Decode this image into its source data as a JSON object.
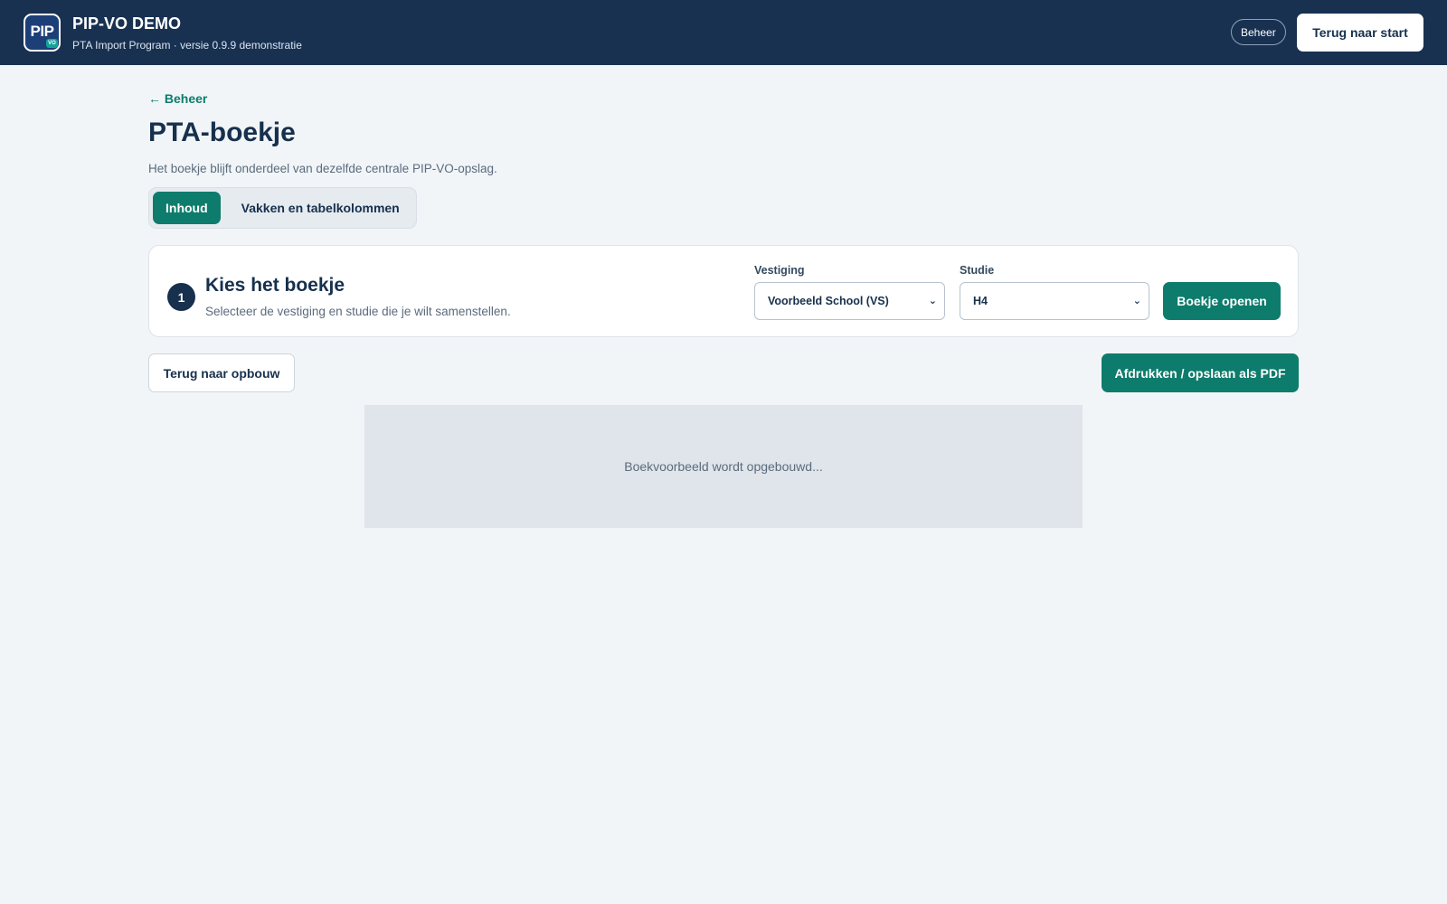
{
  "header": {
    "logo_text": "PIP",
    "logo_badge": "VO",
    "title": "PIP-VO DEMO",
    "subtitle": "PTA Import Program · versie 0.9.9 demonstratie",
    "beheer_label": "Beheer",
    "start_label": "Terug naar start"
  },
  "page": {
    "back_link": "← Beheer",
    "title": "PTA-boekje",
    "subtitle": "Het boekje blijft onderdeel van dezelfde centrale PIP-VO-opslag."
  },
  "tabs": [
    {
      "label": "Inhoud",
      "active": true
    },
    {
      "label": "Vakken en tabelkolommen",
      "active": false
    }
  ],
  "step_card": {
    "number": "1",
    "title": "Kies het boekje",
    "subtitle": "Selecteer de vestiging en studie die je wilt samenstellen.",
    "vestiging_label": "Vestiging",
    "vestiging_value": "Voorbeeld School (VS)",
    "studie_label": "Studie",
    "studie_value": "H4",
    "open_button": "Boekje openen"
  },
  "actions": {
    "back_label": "Terug naar opbouw",
    "print_label": "Afdrukken / opslaan als PDF"
  },
  "preview": {
    "status": "Boekvoorbeeld wordt opgebouwd..."
  },
  "colors": {
    "header_bg": "#183151",
    "accent": "#0d7c6c",
    "page_bg": "#f1f5f8"
  }
}
